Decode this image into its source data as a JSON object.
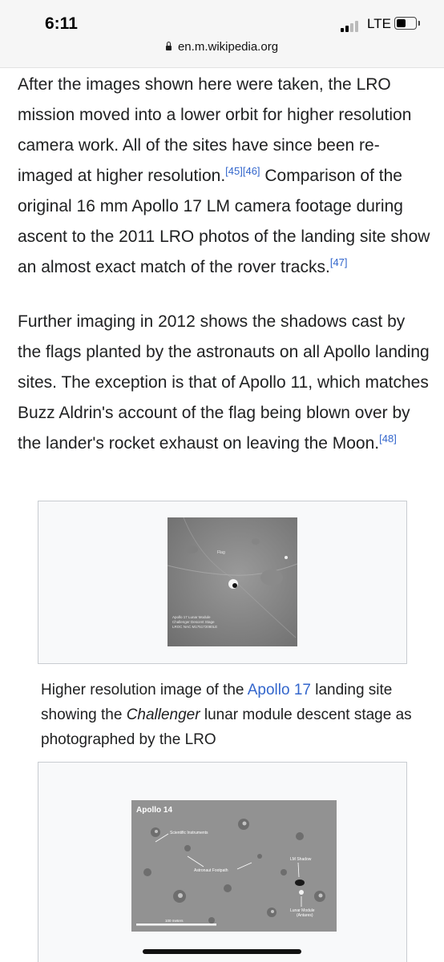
{
  "status": {
    "time": "6:11",
    "carrier": "LTE",
    "url": "en.m.wikipedia.org"
  },
  "article": {
    "para1": {
      "text": "After the images shown here were taken, the LRO mission moved into a lower orbit for higher resolution camera work. All of the sites have since been re-imaged at higher resolution.",
      "ref1": "[45][46]",
      "text2": " Comparison of the original 16 mm Apollo 17 LM camera footage during ascent to the 2011 LRO photos of the landing site show an almost exact match of the rover tracks.",
      "ref2": "[47]"
    },
    "para2": {
      "text": "Further imaging in 2012 shows the shadows cast by the flags planted by the astronauts on all Apollo landing sites. The exception is that of Apollo 11, which matches Buzz Aldrin's account of the flag being blown over by the lander's rocket exhaust on leaving the Moon.",
      "ref": "[48]"
    },
    "figure1": {
      "image_labels": {
        "flag": "Flag",
        "l1": "Apollo 17 Lunar Module",
        "l2": "Challenger Descent Stage",
        "l3": "LROC NAC M175172080LE"
      },
      "caption_pre": "Higher resolution image of the ",
      "caption_link": "Apollo 17",
      "caption_mid": " landing site showing the ",
      "caption_italic": "Challenger",
      "caption_post": " lunar module descent stage as photographed by the LRO"
    },
    "figure2": {
      "image_labels": {
        "title": "Apollo 14",
        "instruments": "Scientific Instruments",
        "footpath": "Astronaut Footpath",
        "shadow": "LM Shadow",
        "module": "Lunar Module",
        "module2": "(Antares)",
        "scale": "100 meters"
      }
    }
  }
}
